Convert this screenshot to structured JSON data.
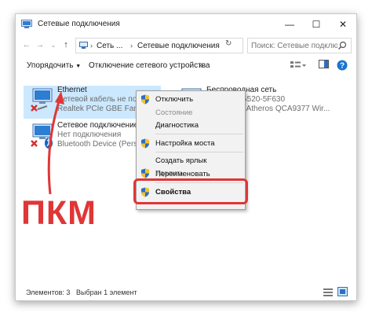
{
  "window": {
    "title": "Сетевые подключения",
    "controls": {
      "minimize": "—",
      "maximize": "☐",
      "close": "✕"
    }
  },
  "address": {
    "segment_1": "Сеть ...",
    "segment_2": "Сетевые подключения",
    "search_placeholder": "Поиск: Сетевые подключ..."
  },
  "commandbar": {
    "organize": "Упорядочить",
    "disable_device": "Отключение сетевого устройства",
    "more": "»"
  },
  "connections": [
    {
      "name": "Ethernet",
      "status": "Сетевой кабель не подключен",
      "device": "Realtek PCIe GBE Family Controller"
    },
    {
      "name": "Беспроводная сеть",
      "status": "Huawei-HG520-5F630",
      "device": "Qualcomm Atheros QCA9377 Wir..."
    },
    {
      "name": "Сетевое подключение Bluetooth",
      "status": "Нет подключения",
      "device": "Bluetooth Device (Personal Area ..."
    }
  ],
  "context_menu": {
    "items": [
      {
        "label": "Отключить",
        "shield": true,
        "disabled": false
      },
      {
        "label": "Состояние",
        "shield": false,
        "disabled": true
      },
      {
        "label": "Диагностика",
        "shield": false,
        "disabled": false
      },
      {
        "label": "Настройка моста",
        "shield": true,
        "disabled": false
      },
      {
        "label": "Создать ярлык",
        "shield": false,
        "disabled": false
      },
      {
        "label": "Удалить",
        "shield": true,
        "disabled": true
      },
      {
        "label": "Переименовать",
        "shield": true,
        "disabled": false
      },
      {
        "label": "Свойства",
        "shield": true,
        "disabled": false
      }
    ]
  },
  "status": {
    "items_count": "Элементов: 3",
    "selected": "Выбран 1 элемент"
  },
  "annotation": {
    "text": "ПКМ"
  },
  "colors": {
    "accent_red": "#e03636",
    "selection": "#cce8ff",
    "link_blue": "#0a5fb4"
  }
}
